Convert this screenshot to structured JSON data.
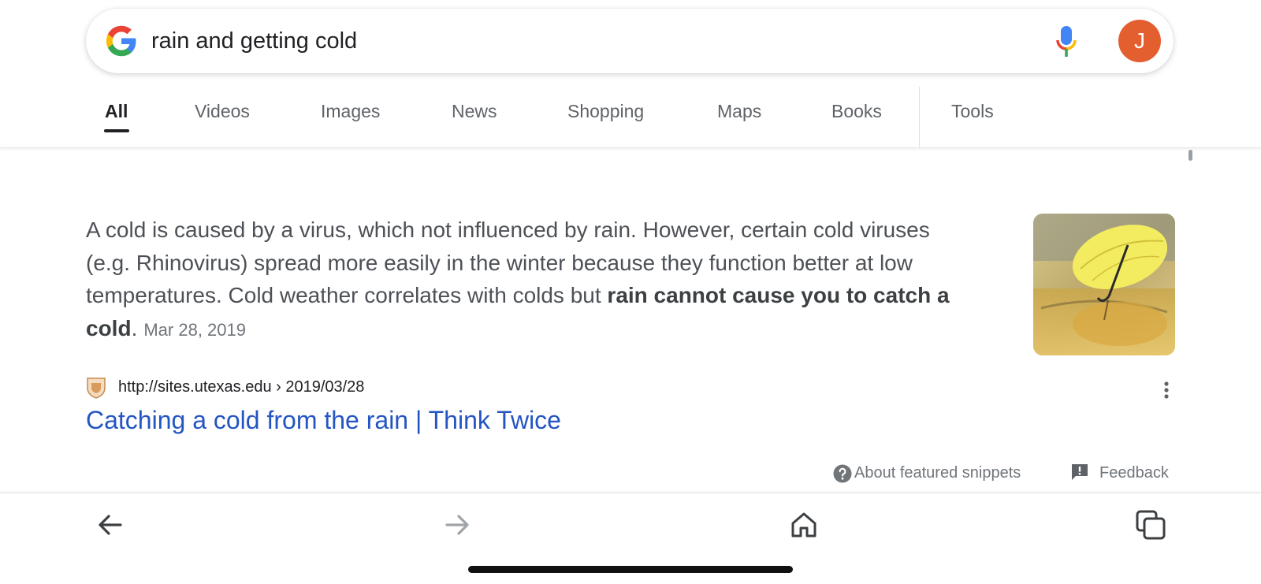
{
  "search": {
    "query": "rain and getting cold",
    "avatar_letter": "J",
    "icons": [
      "google-logo",
      "microphone-icon"
    ]
  },
  "tabs": [
    {
      "label": "All",
      "active": true
    },
    {
      "label": "Videos"
    },
    {
      "label": "Images"
    },
    {
      "label": "News"
    },
    {
      "label": "Shopping"
    },
    {
      "label": "Maps"
    },
    {
      "label": "Books"
    },
    {
      "label": "Tools"
    }
  ],
  "snippet": {
    "text_plain": "A cold is caused by a virus, which not influenced by rain. However, certain cold viruses (e.g. Rhinovirus) spread more easily in the winter because they function better at low temperatures. Cold weather correlates with colds but ",
    "text_bold": "rain cannot cause you to catch a cold",
    "text_end": ".",
    "date": "Mar 28, 2019"
  },
  "result": {
    "url": "http://sites.utexas.edu › 2019/03/28",
    "title": "Catching a cold from the rain | Think Twice"
  },
  "footer_links": {
    "about_snippets": "About featured snippets",
    "feedback": "Feedback"
  },
  "bottom_nav": [
    "back-arrow-icon",
    "forward-arrow-icon",
    "home-icon",
    "tabs-icon"
  ],
  "colors": {
    "link_blue": "#2455c3",
    "avatar_bg": "#e35f2f",
    "text_gray": "#4d5156"
  }
}
